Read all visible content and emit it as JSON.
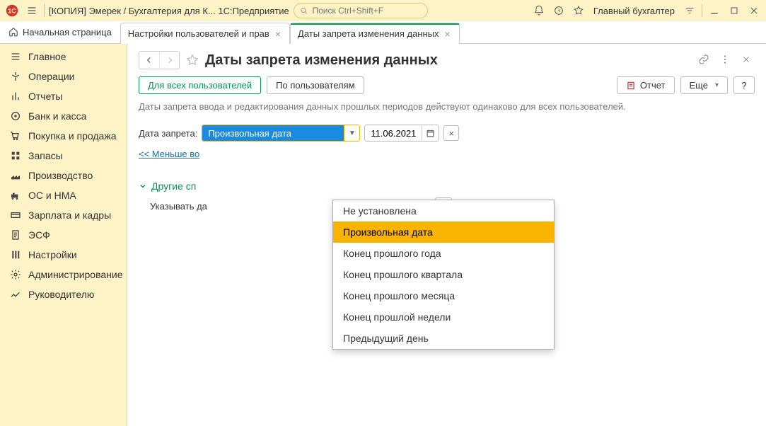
{
  "titlebar": {
    "title": "[КОПИЯ] Эмерек / Бухгалтерия для К...  1С:Предприятие",
    "search_placeholder": "Поиск Ctrl+Shift+F",
    "user": "Главный бухгалтер"
  },
  "tabs": {
    "home": "Начальная страница",
    "t1": "Настройки пользователей и прав",
    "t2": "Даты запрета изменения данных"
  },
  "sidebar": {
    "items": [
      "Главное",
      "Операции",
      "Отчеты",
      "Банк и касса",
      "Покупка и продажа",
      "Запасы",
      "Производство",
      "ОС и НМА",
      "Зарплата и кадры",
      "ЭСФ",
      "Настройки",
      "Администрирование",
      "Руководителю"
    ]
  },
  "page": {
    "title": "Даты запрета изменения данных",
    "mode_all": "Для всех пользователей",
    "mode_by": "По пользователям",
    "report": "Отчет",
    "more": "Еще",
    "help": "?",
    "desc": "Даты запрета ввода и редактирования данных прошлых периодов действуют одинаково для всех пользователей.",
    "label_date": "Дата запрета:",
    "combo_value": "Произвольная дата",
    "date_value": "11.06.2021",
    "less_link": "<< Меньше во",
    "section": "Другие сп",
    "indicate": "Указывать да"
  },
  "dropdown": {
    "items": [
      "Не установлена",
      "Произвольная дата",
      "Конец прошлого года",
      "Конец прошлого квартала",
      "Конец прошлого месяца",
      "Конец прошлой недели",
      "Предыдущий день"
    ],
    "selected_index": 1
  }
}
